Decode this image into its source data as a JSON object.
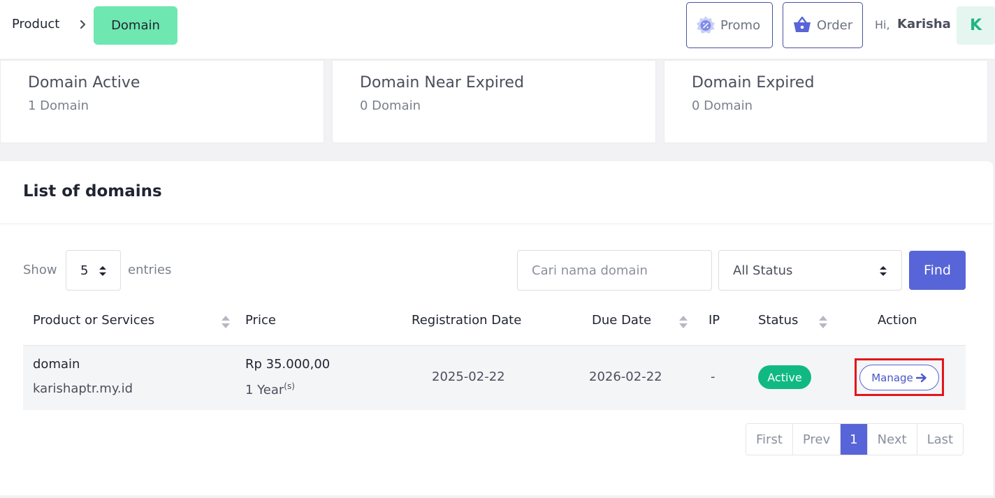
{
  "breadcrumb": {
    "product": "Product",
    "current": "Domain"
  },
  "header": {
    "promo_label": "Promo",
    "order_label": "Order",
    "greeting": "Hi,",
    "user_name": "Karisha",
    "avatar_letter": "K"
  },
  "stats": [
    {
      "title": "Domain Active",
      "count": "1 Domain"
    },
    {
      "title": "Domain Near Expired",
      "count": "0 Domain"
    },
    {
      "title": "Domain Expired",
      "count": "0 Domain"
    }
  ],
  "list": {
    "title": "List of domains",
    "show_label": "Show",
    "entries_value": "5",
    "entries_label": "entries",
    "search_placeholder": "Cari nama domain",
    "status_value": "All Status",
    "find_label": "Find"
  },
  "table": {
    "headers": [
      "Product or Services",
      "Price",
      "Registration Date",
      "Due Date",
      "IP",
      "Status",
      "Action"
    ],
    "rows": [
      {
        "product": "domain",
        "domain": "karishaptr.my.id",
        "price": "Rp 35.000,00",
        "period": "1 Year",
        "period_suffix": "(s)",
        "registration_date": "2025-02-22",
        "due_date": "2026-02-22",
        "ip": "-",
        "status": "Active",
        "action_label": "Manage"
      }
    ]
  },
  "pagination": {
    "first": "First",
    "prev": "Prev",
    "current": "1",
    "next": "Next",
    "last": "Last"
  },
  "colors": {
    "accent": "#5865d8",
    "breadcrumb_active": "#6ee7b0",
    "status_active": "#10b981",
    "highlight": "#e3161c"
  }
}
